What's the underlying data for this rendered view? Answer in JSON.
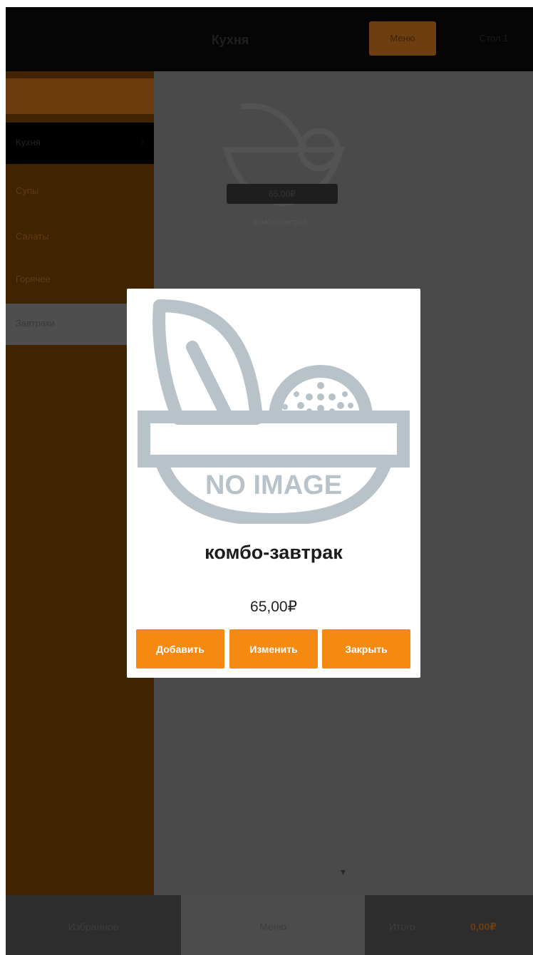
{
  "header": {
    "title": "Кухня",
    "button_label": "Меню",
    "right_label": "Стол 1"
  },
  "sidebar": {
    "items": [
      {
        "label": "Кухня"
      },
      {
        "label": "Супы"
      },
      {
        "label": "Салаты"
      },
      {
        "label": "Горячее"
      },
      {
        "label": "Завтраки"
      }
    ]
  },
  "background_tile": {
    "price": "65,00₽",
    "name": "комбо-завтрак"
  },
  "bottom": {
    "left_label": "Избранное",
    "mid_label": "Меню",
    "right_label": "Итого",
    "right_sum": "0,00₽"
  },
  "modal": {
    "image_text": "NO IMAGE",
    "title": "комбо-завтрак",
    "price": "65,00₽",
    "buttons": {
      "add": "Добавить",
      "edit": "Изменить",
      "close": "Закрыть"
    }
  },
  "colors": {
    "accent": "#f58a12",
    "placeholder_gray": "#b8c3c9"
  }
}
